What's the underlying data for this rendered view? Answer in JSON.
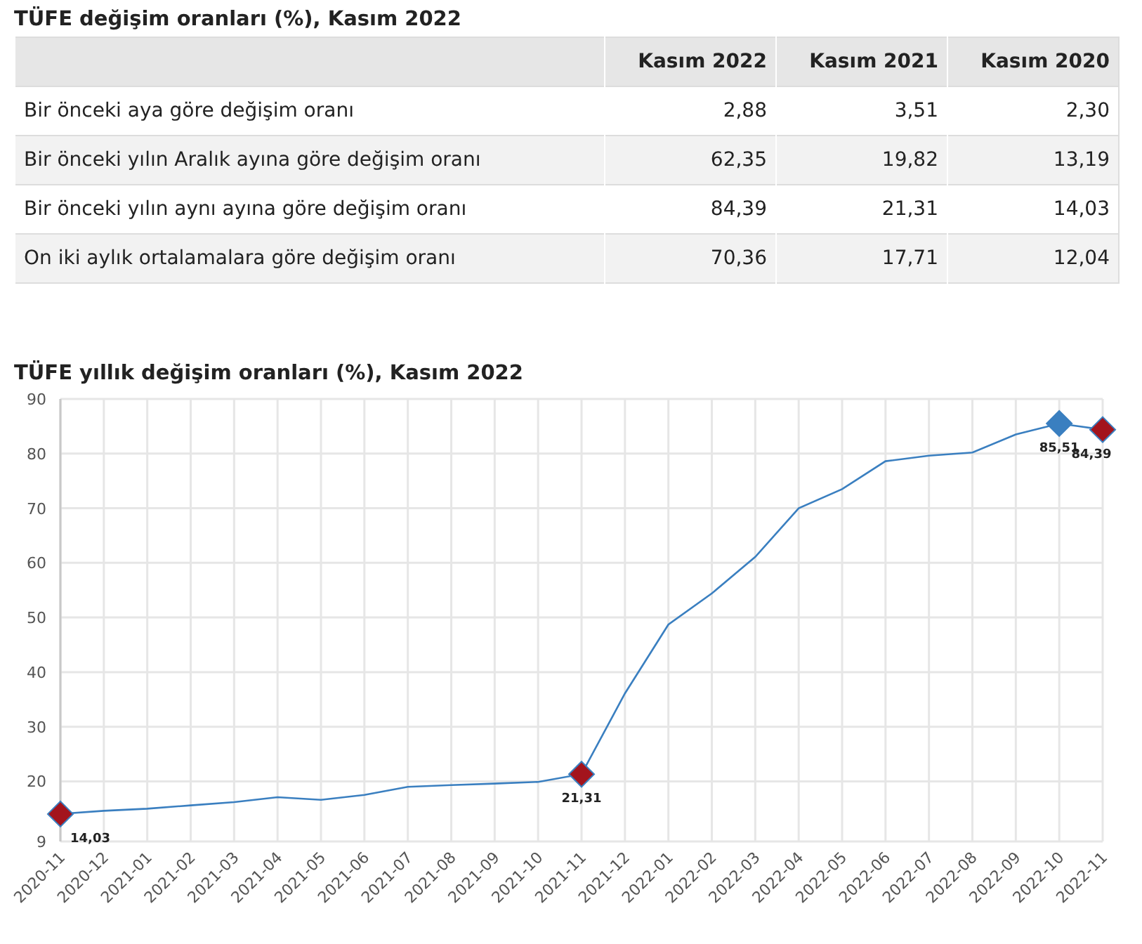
{
  "table": {
    "title": "TÜFE değişim oranları (%), Kasım 2022",
    "columns": [
      "",
      "Kasım 2022",
      "Kasım 2021",
      "Kasım 2020"
    ],
    "rows": [
      {
        "label": "Bir önceki aya göre değişim oranı",
        "values": [
          "2,88",
          "3,51",
          "2,30"
        ]
      },
      {
        "label": "Bir önceki yılın Aralık ayına göre değişim oranı",
        "values": [
          "62,35",
          "19,82",
          "13,19"
        ]
      },
      {
        "label": "Bir önceki yılın aynı ayına göre değişim oranı",
        "values": [
          "84,39",
          "21,31",
          "14,03"
        ]
      },
      {
        "label": "On iki aylık ortalamalara göre değişim oranı",
        "values": [
          "70,36",
          "17,71",
          "12,04"
        ]
      }
    ]
  },
  "chart": {
    "title": "TÜFE yıllık değişim oranları (%), Kasım 2022",
    "chart_data": {
      "type": "line",
      "categories": [
        "2020-11",
        "2020-12",
        "2021-01",
        "2021-02",
        "2021-03",
        "2021-04",
        "2021-05",
        "2021-06",
        "2021-07",
        "2021-08",
        "2021-09",
        "2021-10",
        "2021-11",
        "2021-12",
        "2022-01",
        "2022-02",
        "2022-03",
        "2022-04",
        "2022-05",
        "2022-06",
        "2022-07",
        "2022-08",
        "2022-09",
        "2022-10",
        "2022-11"
      ],
      "series": [
        {
          "color": "#3a7fc0",
          "value_labels": [
            "14,03",
            null,
            null,
            null,
            null,
            null,
            null,
            null,
            null,
            null,
            null,
            null,
            "21,31",
            null,
            null,
            null,
            null,
            null,
            null,
            null,
            null,
            null,
            null,
            "85,51",
            "84,39"
          ],
          "values": [
            14.03,
            14.6,
            15,
            15.6,
            16.2,
            17.1,
            16.6,
            17.5,
            19,
            19.3,
            19.6,
            19.9,
            21.31,
            36.1,
            48.7,
            54.4,
            61.1,
            70,
            73.5,
            78.6,
            79.6,
            80.2,
            83.5,
            85.51,
            84.39
          ]
        }
      ],
      "ylim": [
        9,
        90
      ],
      "yticks": [
        9,
        20,
        30,
        40,
        50,
        60,
        70,
        80,
        90
      ],
      "grid": true
    },
    "markers": [
      {
        "color": "#a3141d"
      },
      {
        "color": "#a3141d"
      },
      {
        "color": "#3a7fc0"
      },
      {
        "color": "#a3141d"
      }
    ]
  }
}
